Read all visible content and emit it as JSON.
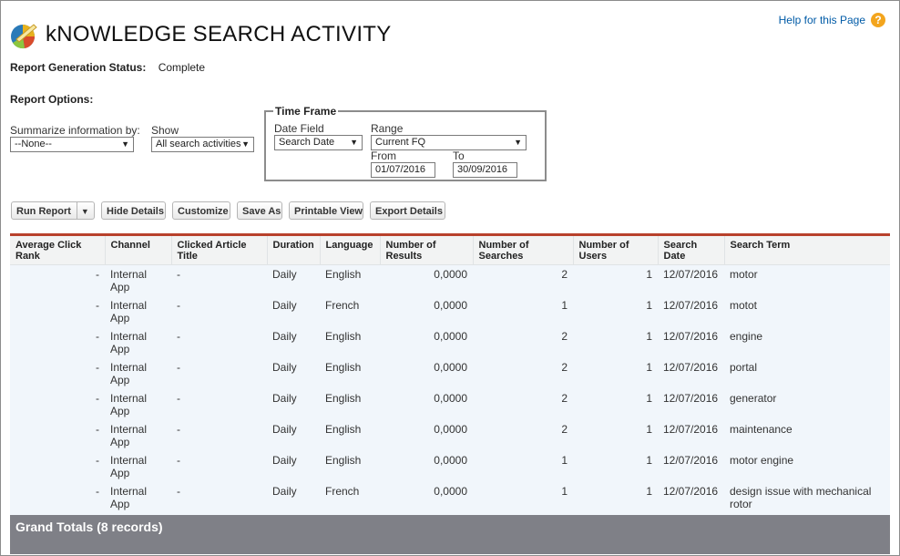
{
  "header": {
    "title": "kNOWLEDGE SEARCH ACTIVITY",
    "help_link": "Help for this Page",
    "help_icon": "?"
  },
  "status": {
    "label": "Report Generation Status:",
    "value": "Complete"
  },
  "options": {
    "label": "Report Options:",
    "summarize_label": "Summarize information by:",
    "summarize_value": "--None--",
    "show_label": "Show",
    "show_value": "All search activities"
  },
  "time_frame": {
    "legend": "Time Frame",
    "date_field_label": "Date Field",
    "date_field_value": "Search Date",
    "range_label": "Range",
    "range_value": "Current FQ",
    "from_label": "From",
    "from_value": "01/07/2016",
    "to_label": "To",
    "to_value": "30/09/2016"
  },
  "toolbar": {
    "run_report": "Run Report",
    "hide_details": "Hide Details",
    "customize": "Customize",
    "save_as": "Save As",
    "printable_view": "Printable View",
    "export_details": "Export Details"
  },
  "table": {
    "columns": [
      "Average Click Rank",
      "Channel",
      "Clicked Article Title",
      "Duration",
      "Language",
      "Number of Results",
      "Number of Searches",
      "Number of Users",
      "Search Date",
      "Search Term"
    ],
    "rows": [
      [
        "-",
        "Internal App",
        "-",
        "Daily",
        "English",
        "0,0000",
        "2",
        "1",
        "12/07/2016",
        "motor"
      ],
      [
        "-",
        "Internal App",
        "-",
        "Daily",
        "French",
        "0,0000",
        "1",
        "1",
        "12/07/2016",
        "motot"
      ],
      [
        "-",
        "Internal App",
        "-",
        "Daily",
        "English",
        "0,0000",
        "2",
        "1",
        "12/07/2016",
        "engine"
      ],
      [
        "-",
        "Internal App",
        "-",
        "Daily",
        "English",
        "0,0000",
        "2",
        "1",
        "12/07/2016",
        "portal"
      ],
      [
        "-",
        "Internal App",
        "-",
        "Daily",
        "English",
        "0,0000",
        "2",
        "1",
        "12/07/2016",
        "generator"
      ],
      [
        "-",
        "Internal App",
        "-",
        "Daily",
        "English",
        "0,0000",
        "2",
        "1",
        "12/07/2016",
        "maintenance"
      ],
      [
        "-",
        "Internal App",
        "-",
        "Daily",
        "English",
        "0,0000",
        "1",
        "1",
        "12/07/2016",
        "motor engine"
      ],
      [
        "-",
        "Internal App",
        "-",
        "Daily",
        "French",
        "0,0000",
        "1",
        "1",
        "12/07/2016",
        "design issue with mechanical rotor"
      ]
    ]
  },
  "grand_totals": "Grand Totals (8 records)",
  "colors": {
    "accent": "#b8412c",
    "link": "#015ba7",
    "help": "#f3a51d",
    "totals_bg": "#7f8087"
  }
}
